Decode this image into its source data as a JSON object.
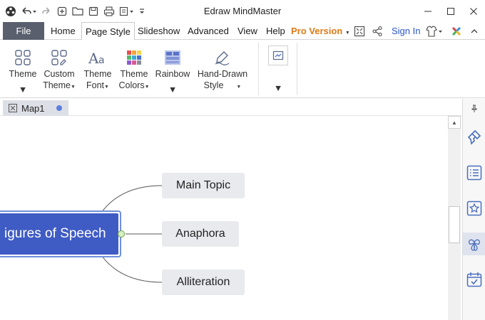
{
  "app": {
    "title": "Edraw MindMaster"
  },
  "quick_access": [
    "logo-icon",
    "undo-icon",
    "redo-icon",
    "new-icon",
    "open-icon",
    "save-icon",
    "print-icon",
    "export-icon",
    "customize-icon"
  ],
  "window_controls": [
    "minimize-icon",
    "maximize-icon",
    "close-icon"
  ],
  "menu": {
    "file": "File",
    "home": "Home",
    "page_style": "Page Style",
    "slideshow": "Slideshow",
    "advanced": "Advanced",
    "view": "View",
    "help": "Help",
    "pro_version": "Pro Version",
    "sign_in": "Sign In"
  },
  "ribbon": {
    "theme": "Theme",
    "custom_theme_1": "Custom",
    "custom_theme_2": "Theme",
    "theme_font_1": "Theme",
    "theme_font_2": "Font",
    "theme_colors_1": "Theme",
    "theme_colors_2": "Colors",
    "rainbow": "Rainbow",
    "hand_drawn_1": "Hand-Drawn",
    "hand_drawn_2": "Style"
  },
  "document": {
    "tab_label": "Map1"
  },
  "mindmap": {
    "central_topic": "igures of Speech",
    "topics": [
      "Main Topic",
      "Anaphora",
      "Alliteration"
    ]
  },
  "colors": {
    "central_fill": "#3f5bc4",
    "topic_fill": "#e9eaee",
    "pro_accent": "#e07a16",
    "link_blue": "#2a56c6"
  },
  "right_panel": [
    "pin-icon",
    "format-brush-icon",
    "outline-list-icon",
    "clipart-icon",
    "theme-style-icon",
    "task-icon"
  ]
}
